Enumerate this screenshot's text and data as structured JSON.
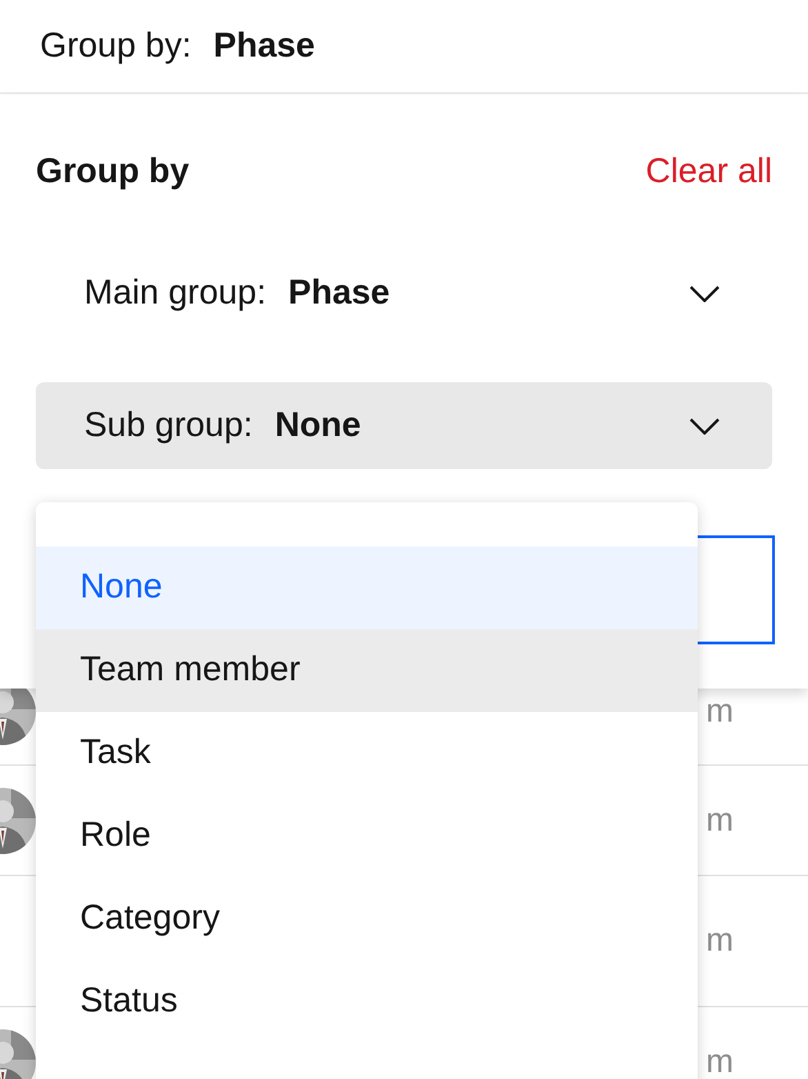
{
  "top_bar": {
    "label": "Group by:",
    "value": "Phase"
  },
  "background_rows": [
    {
      "avatar": true,
      "column_2": "m"
    },
    {
      "avatar": true,
      "column_2": "m"
    },
    {
      "avatar": false,
      "column_2": "m"
    },
    {
      "avatar": true,
      "column_2": "m"
    }
  ],
  "panel": {
    "title": "Group by",
    "clear_link": "Clear all",
    "selects": [
      {
        "label": "Main group:",
        "value": "Phase",
        "open": false
      },
      {
        "label": "Sub group:",
        "value": "None",
        "open": true
      }
    ],
    "menu_items": [
      {
        "label": "None",
        "selected": true,
        "hovered": false
      },
      {
        "label": "Team member",
        "selected": false,
        "hovered": true
      },
      {
        "label": "Task",
        "selected": false,
        "hovered": false
      },
      {
        "label": "Role",
        "selected": false,
        "hovered": false
      },
      {
        "label": "Category",
        "selected": false,
        "hovered": false
      },
      {
        "label": "Status",
        "selected": false,
        "hovered": false
      }
    ]
  }
}
